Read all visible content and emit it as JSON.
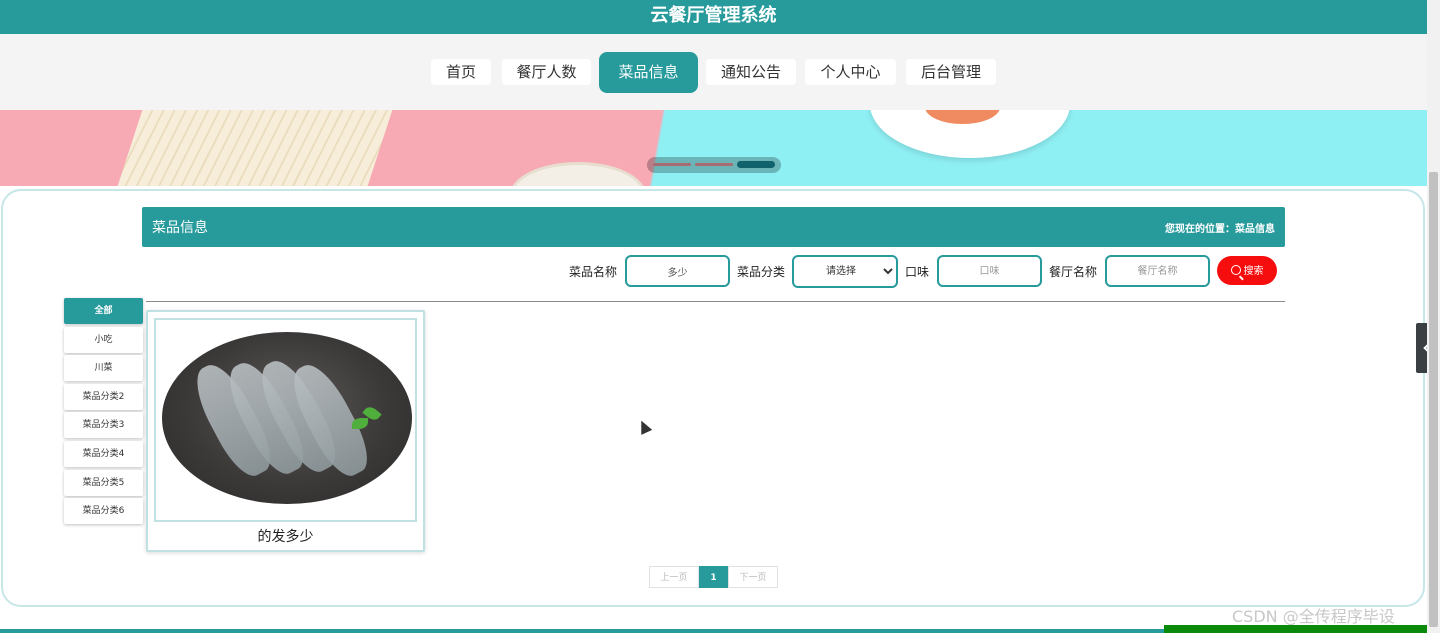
{
  "app": {
    "title": "云餐厅管理系统"
  },
  "nav": {
    "items": [
      {
        "label": "首页"
      },
      {
        "label": "餐厅人数"
      },
      {
        "label": "菜品信息"
      },
      {
        "label": "通知公告"
      },
      {
        "label": "个人中心"
      },
      {
        "label": "后台管理"
      }
    ],
    "active": "菜品信息"
  },
  "section": {
    "title": "菜品信息",
    "location": "您现在的位置：菜品信息"
  },
  "filters": {
    "name_label": "菜品名称",
    "name_value": "多少",
    "category_label": "菜品分类",
    "category_selected": "请选择",
    "taste_label": "口味",
    "taste_placeholder": "口味",
    "restaurant_label": "餐厅名称",
    "restaurant_placeholder": "餐厅名称",
    "search_label": "搜索"
  },
  "categories": [
    {
      "label": "全部"
    },
    {
      "label": "小吃"
    },
    {
      "label": "川菜"
    },
    {
      "label": "菜品分类2"
    },
    {
      "label": "菜品分类3"
    },
    {
      "label": "菜品分类4"
    },
    {
      "label": "菜品分类5"
    },
    {
      "label": "菜品分类6"
    }
  ],
  "dishes": [
    {
      "name": "的发多少"
    }
  ],
  "pagination": {
    "prev": "上一页",
    "current": "1",
    "next": "下一页"
  },
  "watermark": "CSDN @全传程序毕设",
  "colors": {
    "primary": "#279a9c",
    "search": "#f60d0d"
  },
  "icons": {
    "search": "search-icon",
    "side_toggle": "chevron-left-icon"
  }
}
